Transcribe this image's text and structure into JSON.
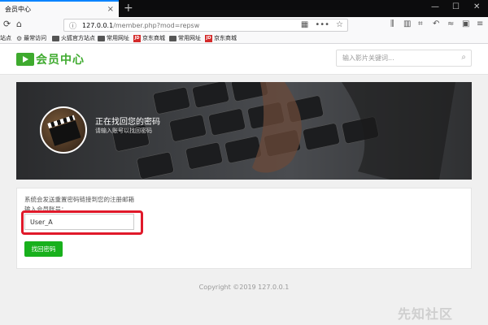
{
  "browser": {
    "tab_title": "会员中心",
    "tab_close": "×",
    "new_tab": "+",
    "window_controls": [
      "—",
      "☐",
      "✕"
    ],
    "url_host": "127.0.0.1",
    "url_path": "/member.php?mod=repsw",
    "url_more": "•••",
    "bookmarks": [
      {
        "label": "站点",
        "icon": "none"
      },
      {
        "label": "最常访问",
        "icon": "gear"
      },
      {
        "label": "火狐官方站点",
        "icon": "folder"
      },
      {
        "label": "常用网址",
        "icon": "folder"
      },
      {
        "label": "京东商城",
        "icon": "jd"
      },
      {
        "label": "常用网址",
        "icon": "folder"
      },
      {
        "label": "京东商城",
        "icon": "jd"
      }
    ]
  },
  "site": {
    "logo_text": "会员中心",
    "search_placeholder": "输入影片关键词..."
  },
  "banner": {
    "title": "正在找回您的密码",
    "subtitle": "请输入账号以找回密码"
  },
  "form": {
    "hint": "系统会发送重置密码链接到您的注册邮箱",
    "label": "输入会员账号：",
    "username_value": "User_A",
    "submit_label": "找回密码"
  },
  "footer": {
    "copyright": "Copyright ©2019 127.0.0.1"
  },
  "watermark": "先知社区",
  "colors": {
    "accent_green": "#18b01c",
    "highlight_red": "#e0192a",
    "firefox_blue": "#0a84ff"
  }
}
